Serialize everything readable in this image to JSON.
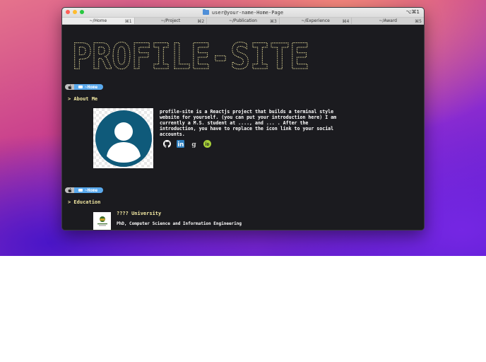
{
  "window": {
    "title": "user@your-name-Home-Page",
    "shortcut": "⌥⌘1"
  },
  "tabs": [
    {
      "label": "~/Home",
      "key": "⌘1"
    },
    {
      "label": "~/Project",
      "key": "⌘2"
    },
    {
      "label": "~/Publication",
      "key": "⌘3"
    },
    {
      "label": "~/Experience",
      "key": "⌘4"
    },
    {
      "label": "~/Award",
      "key": "⌘5"
    }
  ],
  "banner": {
    "text": "PROFILE-SITE",
    "color": "#f3e9a3"
  },
  "prompts": [
    {
      "path": "~Home"
    },
    {
      "path": "~Home"
    }
  ],
  "about": {
    "heading": "> About Me",
    "line1": "profile-site is a Reactjs project that builds a terminal style",
    "line2": "website for yourself. (you can put your introduction here) I am",
    "line3": "currently a M.S. student at ...., and  ...  . After the",
    "line4": "introduction, you have to replace the icon link to your social",
    "line5": "accounts.",
    "social_icons": [
      "github-icon",
      "linkedin-icon",
      "google-scholar-icon",
      "orcid-icon"
    ]
  },
  "education": {
    "heading": "> Education",
    "items": [
      {
        "name": "???? University",
        "degree": "PhD, Computer Science and Information Engineering"
      }
    ]
  },
  "colors": {
    "accent": "#5aa9ec",
    "heading": "#f3e9a3",
    "terminal_bg": "#1b1b1f",
    "avatar": "#0f5a7a"
  }
}
